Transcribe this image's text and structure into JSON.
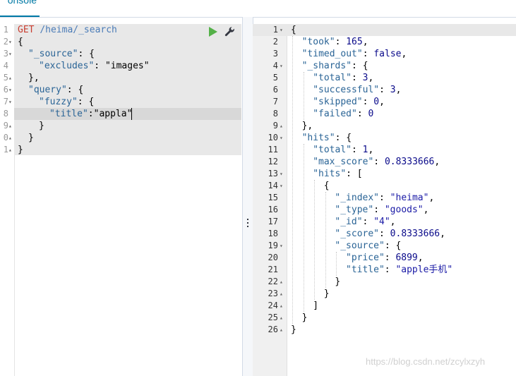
{
  "tab": {
    "label": "onsole"
  },
  "request": {
    "lines": [
      {
        "num": "1",
        "fold": "",
        "method": "GET",
        "path": "/heima/_search"
      },
      {
        "num": "2",
        "fold": "▾",
        "text": "{"
      },
      {
        "num": "3",
        "fold": "▾",
        "key": "\"_source\"",
        "rest": ": {"
      },
      {
        "num": "4",
        "fold": "",
        "key": "\"excludes\"",
        "rest": ": ",
        "val": "\"images\""
      },
      {
        "num": "5",
        "fold": "▴",
        "text": "},"
      },
      {
        "num": "6",
        "fold": "▾",
        "key": "\"query\"",
        "rest": ": {"
      },
      {
        "num": "7",
        "fold": "▾",
        "key": "\"fuzzy\"",
        "rest": ": {"
      },
      {
        "num": "8",
        "fold": "",
        "key": "\"title\"",
        "rest": ":",
        "val": "\"appla\""
      },
      {
        "num": "9",
        "fold": "▴",
        "text": "}"
      },
      {
        "num": "0",
        "fold": "▴",
        "text": "}"
      },
      {
        "num": "1",
        "fold": "▴",
        "text": "}"
      }
    ]
  },
  "response": {
    "lines": [
      {
        "num": "1",
        "fold": "▾",
        "text": "{"
      },
      {
        "num": "2",
        "fold": "",
        "key": "\"took\"",
        "rest": ": ",
        "val": "165",
        "tail": ","
      },
      {
        "num": "3",
        "fold": "",
        "key": "\"timed_out\"",
        "rest": ": ",
        "val": "false",
        "tail": ","
      },
      {
        "num": "4",
        "fold": "▾",
        "key": "\"_shards\"",
        "rest": ": {"
      },
      {
        "num": "5",
        "fold": "",
        "key": "\"total\"",
        "rest": ": ",
        "val": "3",
        "tail": ","
      },
      {
        "num": "6",
        "fold": "",
        "key": "\"successful\"",
        "rest": ": ",
        "val": "3",
        "tail": ","
      },
      {
        "num": "7",
        "fold": "",
        "key": "\"skipped\"",
        "rest": ": ",
        "val": "0",
        "tail": ","
      },
      {
        "num": "8",
        "fold": "",
        "key": "\"failed\"",
        "rest": ": ",
        "val": "0"
      },
      {
        "num": "9",
        "fold": "▴",
        "text": "},"
      },
      {
        "num": "10",
        "fold": "▾",
        "key": "\"hits\"",
        "rest": ": {"
      },
      {
        "num": "11",
        "fold": "",
        "key": "\"total\"",
        "rest": ": ",
        "val": "1",
        "tail": ","
      },
      {
        "num": "12",
        "fold": "",
        "key": "\"max_score\"",
        "rest": ": ",
        "val": "0.8333666",
        "tail": ","
      },
      {
        "num": "13",
        "fold": "▾",
        "key": "\"hits\"",
        "rest": ": ["
      },
      {
        "num": "14",
        "fold": "▾",
        "text": "{"
      },
      {
        "num": "15",
        "fold": "",
        "key": "\"_index\"",
        "rest": ": ",
        "val": "\"heima\"",
        "tail": ","
      },
      {
        "num": "16",
        "fold": "",
        "key": "\"_type\"",
        "rest": ": ",
        "val": "\"goods\"",
        "tail": ","
      },
      {
        "num": "17",
        "fold": "",
        "key": "\"_id\"",
        "rest": ": ",
        "val": "\"4\"",
        "tail": ","
      },
      {
        "num": "18",
        "fold": "",
        "key": "\"_score\"",
        "rest": ": ",
        "val": "0.8333666",
        "tail": ","
      },
      {
        "num": "19",
        "fold": "▾",
        "key": "\"_source\"",
        "rest": ": {"
      },
      {
        "num": "20",
        "fold": "",
        "key": "\"price\"",
        "rest": ": ",
        "val": "6899",
        "tail": ","
      },
      {
        "num": "21",
        "fold": "",
        "key": "\"title\"",
        "rest": ": ",
        "val": "\"apple手机\""
      },
      {
        "num": "22",
        "fold": "▴",
        "text": "}"
      },
      {
        "num": "23",
        "fold": "▴",
        "text": "}"
      },
      {
        "num": "24",
        "fold": "▴",
        "text": "]"
      },
      {
        "num": "25",
        "fold": "▴",
        "text": "}"
      },
      {
        "num": "26",
        "fold": "▴",
        "text": "}"
      }
    ]
  },
  "watermark": "https://blog.csdn.net/zcylxzyh",
  "colors": {
    "accent": "#0079a5",
    "play": "#54b148",
    "method": "#c93d2f"
  },
  "icons": {
    "run": "play-icon",
    "settings": "wrench-icon",
    "resize": "drag-handle-icon"
  }
}
